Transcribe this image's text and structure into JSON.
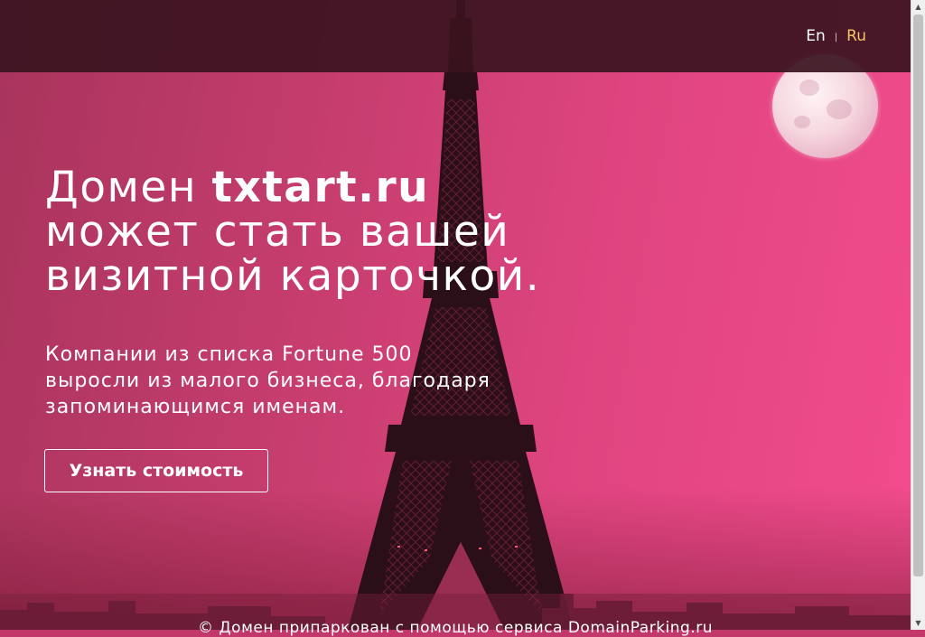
{
  "header": {
    "languages": [
      {
        "label": "En",
        "active": false
      },
      {
        "label": "Ru",
        "active": true
      }
    ],
    "separator": "|"
  },
  "hero": {
    "headline_prefix": "Домен ",
    "domain": "txtart.ru",
    "headline_line2": "может стать вашей",
    "headline_line3": "визитной карточкой.",
    "subtitle_line1": "Компании из списка Fortune 500",
    "subtitle_line2": "выросли из малого бизнеса, благодаря",
    "subtitle_line3": "запоминающимся именам.",
    "cta_label": "Узнать стоимость"
  },
  "footer": {
    "text": "© Домен припаркован с помощью сервиса DomainParking.ru"
  },
  "colors": {
    "topbar": "#3a1420",
    "active_language": "#f3c56a",
    "sky": "#e04580"
  }
}
